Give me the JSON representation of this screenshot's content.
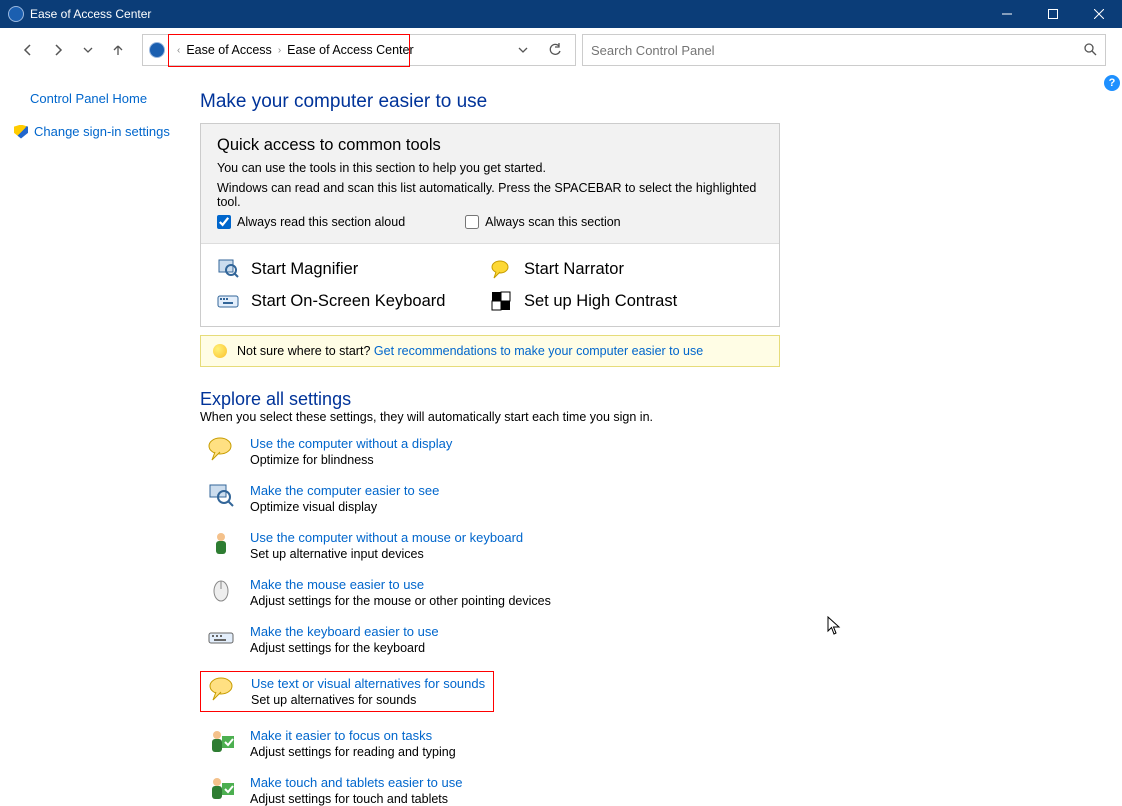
{
  "window": {
    "title": "Ease of Access Center"
  },
  "breadcrumb": {
    "root": "Ease of Access",
    "page": "Ease of Access Center"
  },
  "search": {
    "placeholder": "Search Control Panel"
  },
  "sidebar": {
    "home": "Control Panel Home",
    "signin": "Change sign-in settings"
  },
  "main": {
    "title": "Make your computer easier to use",
    "panel": {
      "title": "Quick access to common tools",
      "line1": "You can use the tools in this section to help you get started.",
      "line2": "Windows can read and scan this list automatically.  Press the SPACEBAR to select the highlighted tool.",
      "chk_read": "Always read this section aloud",
      "chk_scan": "Always scan this section",
      "tools": {
        "magnifier": "Start Magnifier",
        "narrator": "Start Narrator",
        "osk": "Start On-Screen Keyboard",
        "contrast": "Set up High Contrast"
      }
    },
    "hint": {
      "q": "Not sure where to start?",
      "link": "Get recommendations to make your computer easier to use"
    },
    "explore": {
      "title": "Explore all settings",
      "sub": "When you select these settings, they will automatically start each time you sign in."
    },
    "settings": [
      {
        "link": "Use the computer without a display",
        "desc": "Optimize for blindness"
      },
      {
        "link": "Make the computer easier to see",
        "desc": "Optimize visual display"
      },
      {
        "link": "Use the computer without a mouse or keyboard",
        "desc": "Set up alternative input devices"
      },
      {
        "link": "Make the mouse easier to use",
        "desc": "Adjust settings for the mouse or other pointing devices"
      },
      {
        "link": "Make the keyboard easier to use",
        "desc": "Adjust settings for the keyboard"
      },
      {
        "link": "Use text or visual alternatives for sounds",
        "desc": "Set up alternatives for sounds"
      },
      {
        "link": "Make it easier to focus on tasks",
        "desc": "Adjust settings for reading and typing"
      },
      {
        "link": "Make touch and tablets easier to use",
        "desc": "Adjust settings for touch and tablets"
      }
    ]
  }
}
